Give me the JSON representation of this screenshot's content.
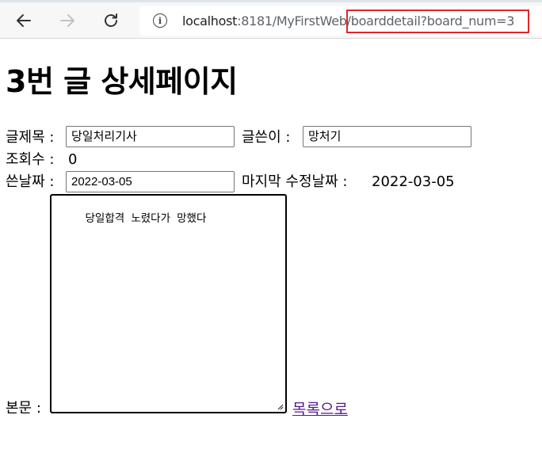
{
  "browser": {
    "url_host": "localhost",
    "url_rest": ":8181/MyFirstWeb/boarddetail?board_num=3",
    "icons": {
      "back": "back-arrow-icon",
      "forward": "forward-arrow-icon",
      "reload": "reload-icon",
      "site_info": "info-icon"
    },
    "highlight_color": "#e0262b"
  },
  "page": {
    "title": "3번 글 상세페이지",
    "subject_label": "글제목 :",
    "subject_value": "당일처리기사",
    "writer_label": "글쓴이 :",
    "writer_value": "망처기",
    "views_label": "조회수 :",
    "views_value": "0",
    "date_label": "쓴날짜 :",
    "date_value": "2022-03-05",
    "modified_label": "마지막 수정날짜 :",
    "modified_value": "2022-03-05",
    "body_label": "본문 :",
    "body_value": "당일합격 노렸다가 망했다",
    "list_link": "목록으로",
    "link_color": "#551a8b"
  }
}
